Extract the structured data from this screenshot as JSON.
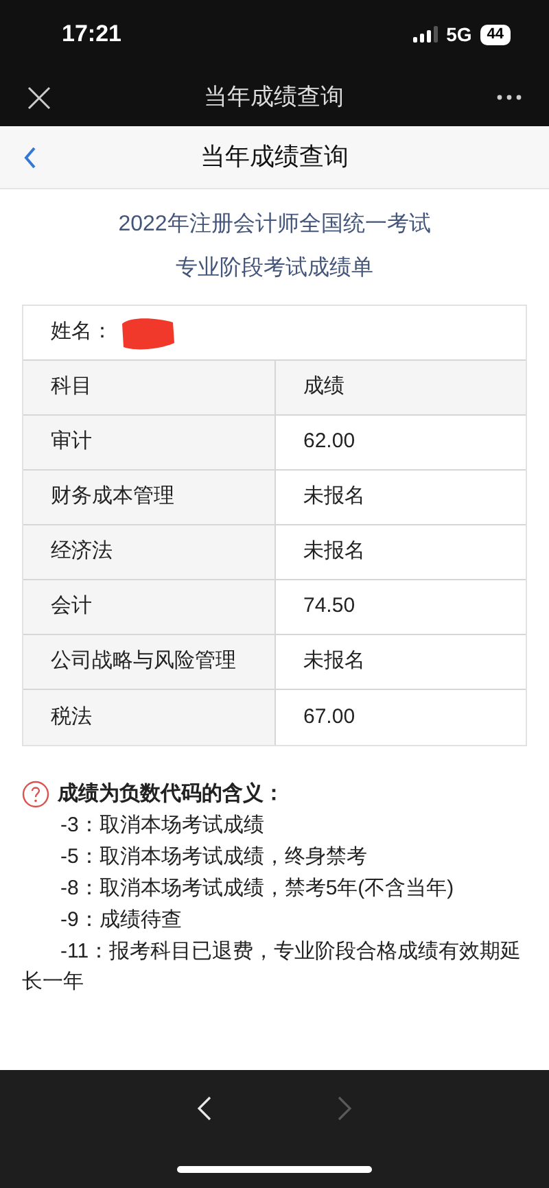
{
  "status_bar": {
    "time": "17:21",
    "network": "5G",
    "battery": "44"
  },
  "top_bar": {
    "title": "当年成绩查询"
  },
  "nav_bar": {
    "title": "当年成绩查询"
  },
  "heading": {
    "line_1": "2022年注册会计师全国统一考试",
    "line_2": "专业阶段考试成绩单"
  },
  "name_row": {
    "label": "姓名："
  },
  "table": {
    "columns": [
      "科目",
      "成绩"
    ],
    "rows": [
      [
        "审计",
        "62.00"
      ],
      [
        "财务成本管理",
        "未报名"
      ],
      [
        "经济法",
        "未报名"
      ],
      [
        "会计",
        "74.50"
      ],
      [
        "公司战略与风险管理",
        "未报名"
      ],
      [
        "税法",
        "67.00"
      ]
    ]
  },
  "notes": {
    "title": "成绩为负数代码的含义：",
    "items": [
      "-3：取消本场考试成绩",
      "-5：取消本场考试成绩，终身禁考",
      "-8：取消本场考试成绩，禁考5年(不含当年)",
      "-9：成绩待查",
      "-11：报考科目已退费，专业阶段合格成绩有效期延长一年"
    ]
  },
  "bottom_bar": {
    "back": {
      "disabled": false
    },
    "forward": {
      "disabled": true
    }
  }
}
